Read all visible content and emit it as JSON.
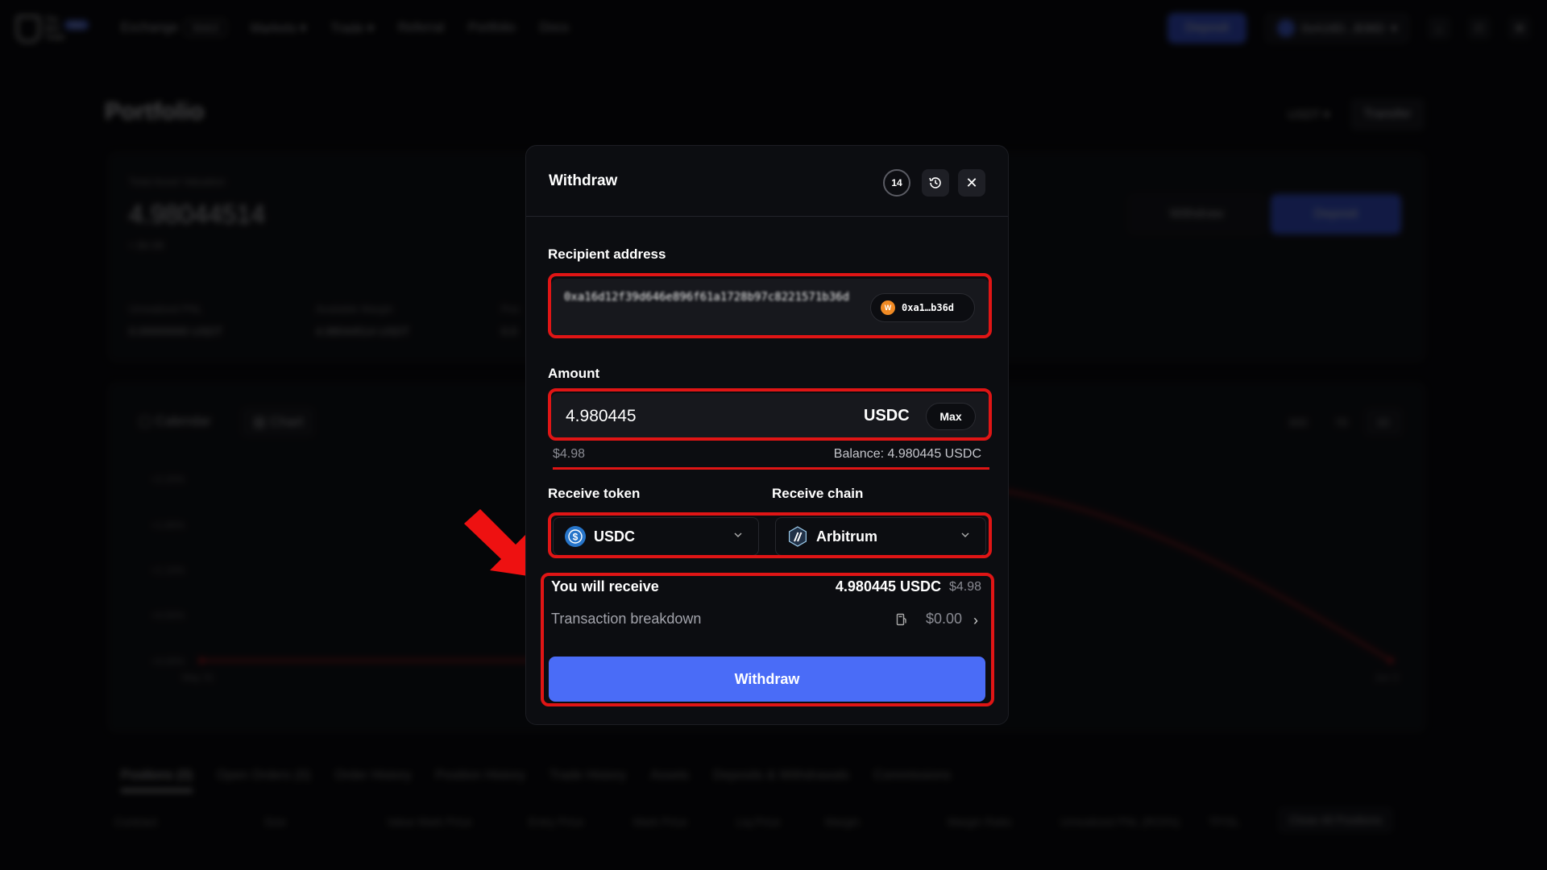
{
  "nav": {
    "logo_words": [
      "The",
      "Bull",
      "Trade"
    ],
    "logo_badge": "New",
    "exchange": "Exchange",
    "exchange_badge": "Web3",
    "markets": "Markets",
    "trade": "Trade",
    "referral": "Referral",
    "portfolio": "Portfolio",
    "docs": "Docs",
    "deposit": "Deposit",
    "wallet": "0xA16D...B36D"
  },
  "page": {
    "title": "Portfolio",
    "currency": "USDT",
    "transfer": "Transfer",
    "total_label": "Total Asset Valuation",
    "total_value": "4.98044514",
    "total_usd": "≈ $4.98",
    "stats": [
      {
        "label": "Unrealized PNL",
        "value": "0.00000000 USDT"
      },
      {
        "label": "Available Margin",
        "value": "4.98044514 USDT"
      },
      {
        "label": "Pos",
        "value": "0.0"
      }
    ],
    "withdraw": "Withdraw",
    "deposit": "Deposit",
    "calendar": "Calendar",
    "chart": "Chart",
    "ranges": [
      "30D",
      "7D",
      "3D"
    ],
    "yticks": [
      "+2.20%",
      "+1.65%",
      "+1.10%",
      "+0.55%",
      "+0.00%"
    ],
    "xticks": [
      "May 31",
      "Jun 3"
    ],
    "tabs": [
      "Positions (0)",
      "Open Orders (0)",
      "Order History",
      "Position History",
      "Trade History",
      "Assets",
      "Deposits & Withdrawals",
      "Commissions"
    ],
    "columns": [
      "Contract",
      "Size",
      "Value Mark Price",
      "Entry Price",
      "Mark Price",
      "Liq.Price",
      "Margin",
      "Margin Ratio",
      "Unrealized PNL (ROI%)",
      "TP/SL"
    ],
    "close_all": "Close All Positions"
  },
  "modal": {
    "title": "Withdraw",
    "badge_count": "14",
    "recipient_label": "Recipient address",
    "recipient_address": "0xa16d12f39d646e896f61a1728b97c8221571b36d",
    "wallet_chip_icon": "W",
    "wallet_chip": "0xa1…b36d",
    "amount_label": "Amount",
    "amount_value": "4.980445",
    "amount_unit": "USDC",
    "max_label": "Max",
    "amount_usd": "$4.98",
    "balance": "Balance: 4.980445 USDC",
    "receive_token_label": "Receive token",
    "receive_token": "USDC",
    "receive_chain_label": "Receive chain",
    "receive_chain": "Arbitrum",
    "you_receive_label": "You will receive",
    "you_receive_amount": "4.980445 USDC",
    "you_receive_usd": "$4.98",
    "breakdown_label": "Transaction breakdown",
    "breakdown_fee": "$0.00",
    "withdraw_button": "Withdraw"
  },
  "colors": {
    "accent": "#4a6cf7",
    "highlight": "#e01515",
    "usdc": "#2775ca",
    "arbitrum": "#213147",
    "chart_line": "#c0181e"
  },
  "icons": [
    "history-icon",
    "close-icon",
    "chevron-down-icon",
    "gas-icon",
    "chevron-right-icon",
    "usdc-icon",
    "arbitrum-icon",
    "annotation-arrow-icon"
  ]
}
